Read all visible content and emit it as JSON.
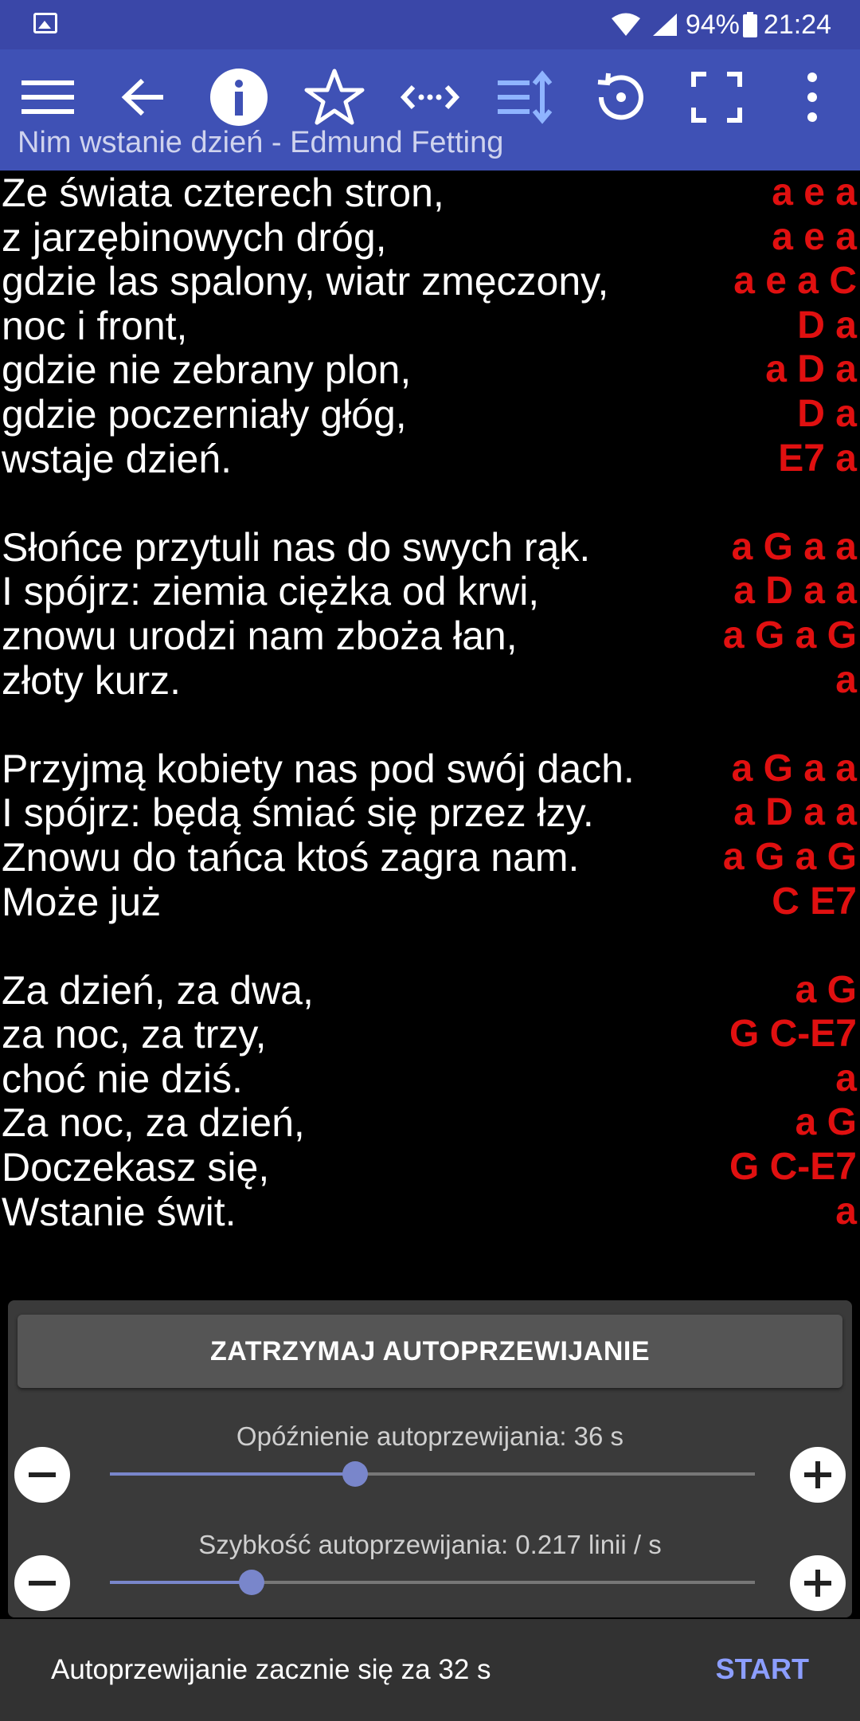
{
  "status_bar": {
    "battery": "94%",
    "time": "21:24"
  },
  "toolbar": {
    "icons": [
      "menu-icon",
      "back-arrow-icon",
      "info-icon",
      "star-icon",
      "transpose-icon",
      "autoscroll-icon",
      "history-icon",
      "fullscreen-icon",
      "more-vert-icon"
    ],
    "song_title": "Nim wstanie dzień - Edmund Fetting",
    "accent": "#3f51b5"
  },
  "lyrics": [
    {
      "text": "Ze świata czterech stron,",
      "chords": "a e a"
    },
    {
      "text": "z jarzębinowych dróg,",
      "chords": "a e a"
    },
    {
      "text": "gdzie las spalony, wiatr zmęczony,",
      "chords": "a e a C"
    },
    {
      "text": "noc i front,",
      "chords": "D a"
    },
    {
      "text": "gdzie nie zebrany plon,",
      "chords": "a D a"
    },
    {
      "text": "gdzie poczerniały głóg,",
      "chords": "D a"
    },
    {
      "text": "wstaje dzień.",
      "chords": "E7 a"
    },
    {
      "text": "",
      "chords": ""
    },
    {
      "text": "Słońce przytuli nas do swych rąk.",
      "chords": "a G a a"
    },
    {
      "text": "I spójrz: ziemia ciężka od krwi,",
      "chords": "a D a a"
    },
    {
      "text": "znowu urodzi nam zboża łan,",
      "chords": "a G a G"
    },
    {
      "text": "złoty kurz.",
      "chords": "a"
    },
    {
      "text": "",
      "chords": ""
    },
    {
      "text": "Przyjmą kobiety nas pod swój dach.",
      "chords": "a G a a"
    },
    {
      "text": "I spójrz: będą śmiać się przez łzy.",
      "chords": "a D a a"
    },
    {
      "text": "Znowu do tańca ktoś zagra nam.",
      "chords": "a G a G"
    },
    {
      "text": "Może już",
      "chords": "C E7"
    },
    {
      "text": "",
      "chords": ""
    },
    {
      "text": "Za dzień, za dwa,",
      "chords": "a G"
    },
    {
      "text": "za noc, za trzy,",
      "chords": "G C-E7"
    },
    {
      "text": "choć nie dziś.",
      "chords": "a"
    },
    {
      "text": "Za noc, za dzień,",
      "chords": "a G"
    },
    {
      "text": "Doczekasz się,",
      "chords": "G C-E7"
    },
    {
      "text": "Wstanie świt.",
      "chords": "a"
    }
  ],
  "autoscroll_panel": {
    "stop_button": "ZATRZYMAJ AUTOPRZEWIJANIE",
    "delay_label": "Opóźnienie autoprzewijania: 36 s",
    "delay_fraction": 0.38,
    "speed_label": "Szybkość autoprzewijania: 0.217 linii / s",
    "speed_fraction": 0.22
  },
  "snackbar": {
    "message": "Autoprzewijanie zacznie się za 32 s",
    "action": "START"
  }
}
